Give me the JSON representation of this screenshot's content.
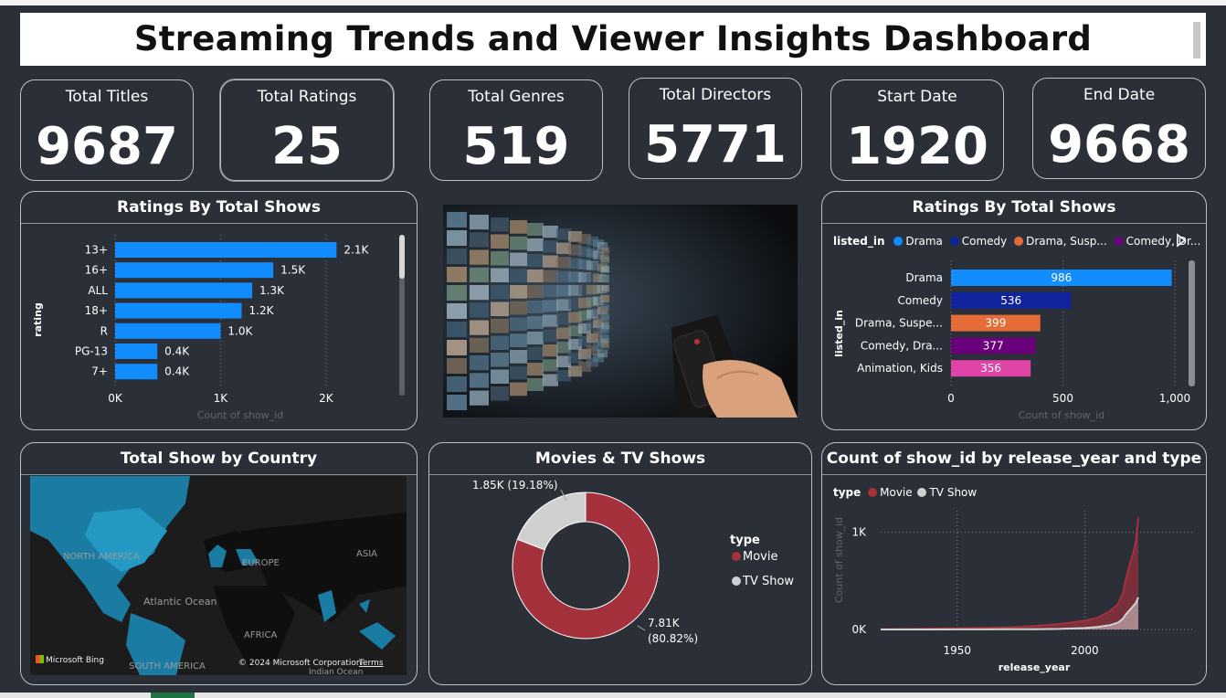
{
  "dashboard": {
    "title": "Streaming Trends and Viewer Insights Dashboard"
  },
  "kpis": [
    {
      "label": "Total Titles",
      "value": "9687"
    },
    {
      "label": "Total Ratings",
      "value": "25"
    },
    {
      "label": "Total Genres",
      "value": "519"
    },
    {
      "label": "Total Directors",
      "value": "5771"
    },
    {
      "label": "Start Date",
      "value": "1920"
    },
    {
      "label": "End Date",
      "value": "9668"
    }
  ],
  "colors": {
    "bar_blue": "#118dff",
    "navy": "#12239e",
    "orange": "#e66c37",
    "purple": "#6b007b",
    "pink": "#e044a7",
    "movie": "#a4313c",
    "tvshow": "#d0d0d0",
    "background": "#2b3038"
  },
  "chart_data": [
    {
      "type": "bar",
      "title": "Ratings By Total Shows",
      "ylabel": "rating",
      "xlabel": "Count of show_id",
      "categories": [
        "13+",
        "16+",
        "ALL",
        "18+",
        "R",
        "PG-13",
        "7+"
      ],
      "values": [
        2100,
        1500,
        1300,
        1200,
        1000,
        400,
        400
      ],
      "data_labels": [
        "2.1K",
        "1.5K",
        "1.3K",
        "1.2K",
        "1.0K",
        "0.4K",
        "0.4K"
      ],
      "xticks": [
        "0K",
        "1K",
        "2K"
      ],
      "xlim": [
        0,
        2400
      ],
      "grid": true
    },
    {
      "type": "bar",
      "title": "Ratings By Total Shows",
      "legend_title": "listed_in",
      "legend": [
        "Drama",
        "Comedy",
        "Drama, Susp...",
        "Comedy, Dr..."
      ],
      "ylabel": "listed_in",
      "xlabel": "Count of show_id",
      "categories": [
        "Drama",
        "Comedy",
        "Drama, Suspe...",
        "Comedy, Dra...",
        "Animation, Kids"
      ],
      "values": [
        986,
        536,
        399,
        377,
        356
      ],
      "data_labels": [
        "986",
        "536",
        "399",
        "377",
        "356"
      ],
      "xticks": [
        "0",
        "500",
        "1,000"
      ],
      "xlim": [
        0,
        1000
      ],
      "grid": true
    },
    {
      "type": "pie",
      "title": "Movies & TV Shows",
      "legend_title": "type",
      "slices": [
        {
          "name": "Movie",
          "value": 7810,
          "label": "7.81K",
          "pct": "(80.82%)"
        },
        {
          "name": "TV Show",
          "value": 1850,
          "label": "1.85K (19.18%)"
        }
      ]
    },
    {
      "type": "area",
      "title": "Count of show_id by release_year and type",
      "legend_title": "type",
      "xlabel": "release_year",
      "ylabel": "Count of show_id",
      "xticks": [
        "1950",
        "2000"
      ],
      "yticks": [
        "0K",
        "1K"
      ],
      "xlim": [
        1920,
        2021
      ],
      "ylim": [
        0,
        1200
      ],
      "grid": true,
      "series": [
        {
          "name": "Movie",
          "x": [
            1920,
            1930,
            1940,
            1950,
            1960,
            1970,
            1980,
            1990,
            2000,
            2005,
            2010,
            2013,
            2015,
            2016,
            2017,
            2018,
            2019,
            2020,
            2021
          ],
          "values": [
            3,
            6,
            10,
            12,
            16,
            22,
            35,
            55,
            90,
            120,
            190,
            260,
            380,
            500,
            600,
            700,
            780,
            900,
            1150
          ]
        },
        {
          "name": "TV Show",
          "x": [
            1920,
            1930,
            1940,
            1950,
            1960,
            1970,
            1980,
            1990,
            2000,
            2005,
            2010,
            2013,
            2015,
            2016,
            2017,
            2018,
            2019,
            2020,
            2021
          ],
          "values": [
            0,
            0,
            0,
            1,
            1,
            2,
            3,
            6,
            15,
            25,
            45,
            70,
            110,
            150,
            180,
            210,
            240,
            270,
            330
          ]
        }
      ]
    }
  ],
  "map": {
    "title": "Total Show by Country",
    "labels": {
      "north_america": "NORTH AMERICA",
      "europe": "EUROPE",
      "asia": "ASIA",
      "atlantic": "Atlantic Ocean",
      "africa": "AFRICA",
      "south_america": "SOUTH AMERICA",
      "indian": "Indian Ocean"
    },
    "bing": "Microsoft Bing",
    "copyright": "© 2024 Microsoft Corporation",
    "terms": "Terms"
  }
}
